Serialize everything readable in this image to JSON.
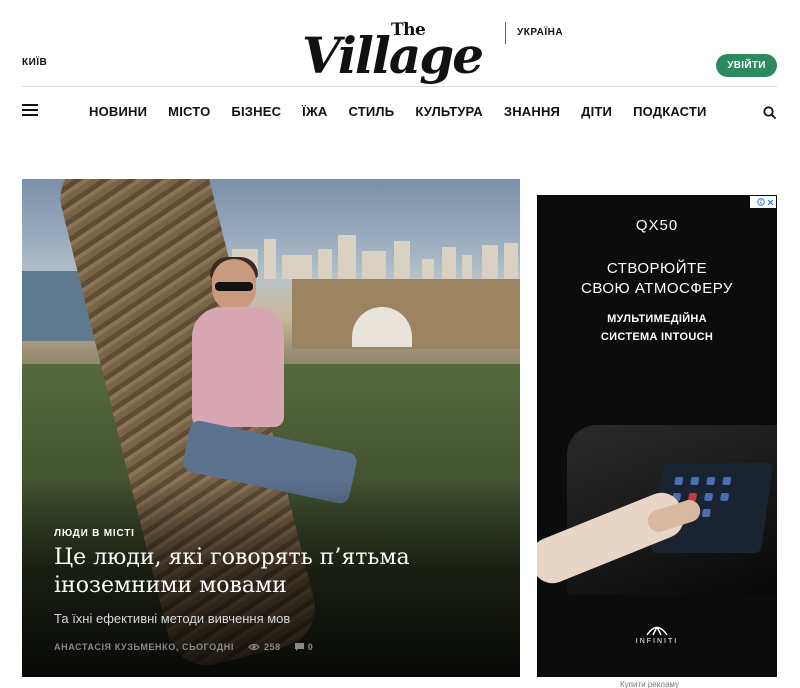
{
  "header": {
    "city": "КИЇВ",
    "logo_the": "The",
    "logo_village": "Village",
    "country": "УКРАЇНА",
    "login_label": "УВІЙТИ",
    "colors": {
      "accent_red": "#d23b2c",
      "login_green": "#2c8a5e"
    }
  },
  "nav": {
    "items": [
      {
        "label": "НОВИНИ"
      },
      {
        "label": "МІСТО"
      },
      {
        "label": "БІЗНЕС"
      },
      {
        "label": "ЇЖА"
      },
      {
        "label": "СТИЛЬ"
      },
      {
        "label": "КУЛЬТУРА"
      },
      {
        "label": "ЗНАННЯ"
      },
      {
        "label": "ДІТИ"
      },
      {
        "label": "ПОДКАСТИ"
      }
    ],
    "menu_icon": "hamburger-icon",
    "search_icon": "search-icon"
  },
  "article": {
    "rubric": "ЛЮДИ В МІСТІ",
    "title": "Це люди, які говорять п’ятьма іноземними мовами",
    "subtitle": "Та їхні ефективні методи вивчення мов",
    "meta": {
      "author_date": "АНАСТАСІЯ КУЗЬМЕНКО, СЬОГОДНІ",
      "views": "258",
      "comments": "0"
    }
  },
  "ad": {
    "model": "QX50",
    "headline_line1": "СТВОРЮЙТЕ",
    "headline_line2": "СВОЮ АТМОСФЕРУ",
    "feature_line1": "МУЛЬТИМЕДІЙНА",
    "feature_line2": "СИСТЕМА INTOUCH",
    "brand": "INFINITI",
    "below_label": "Купити рекламу"
  }
}
